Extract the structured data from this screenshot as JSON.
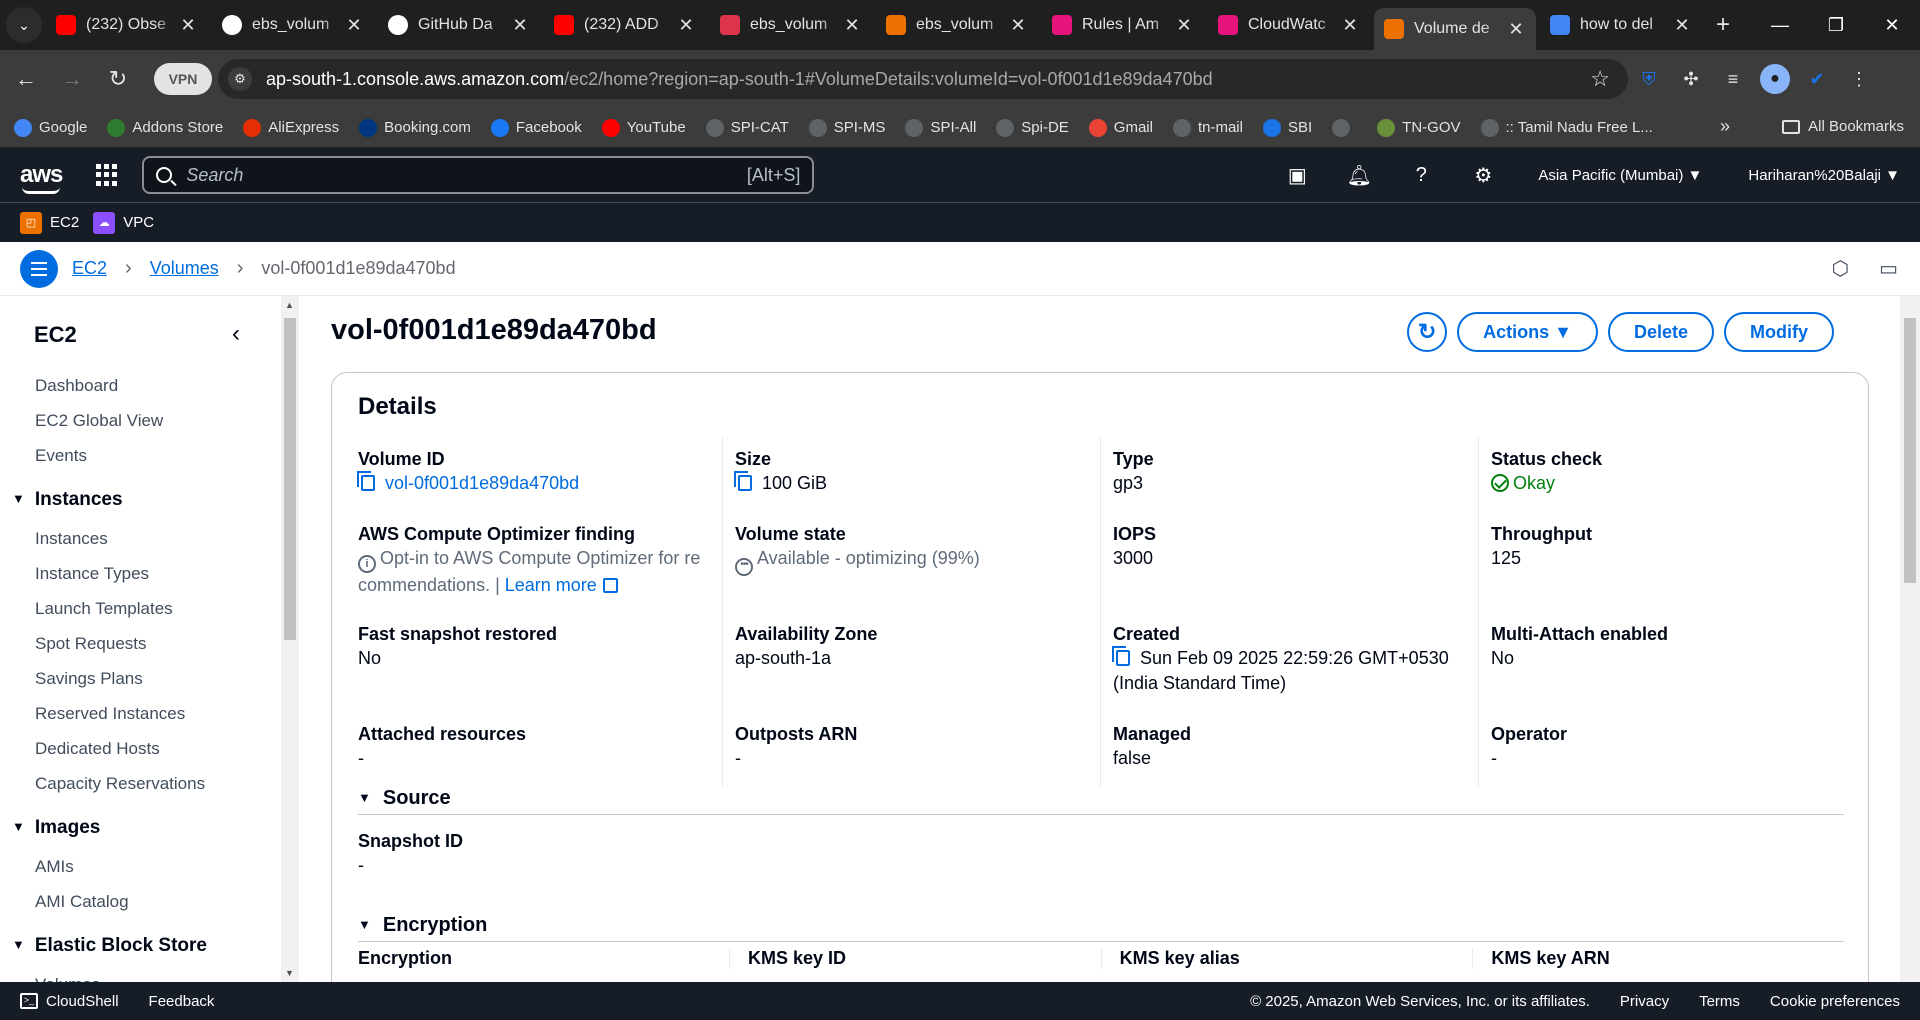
{
  "browser": {
    "tabs": [
      {
        "title": "(232) Obse",
        "favicon": "youtube-icon",
        "color": "#ff0000"
      },
      {
        "title": "ebs_volum",
        "favicon": "github-icon",
        "color": "#ffffff"
      },
      {
        "title": "GitHub Da",
        "favicon": "github-icon",
        "color": "#ffffff"
      },
      {
        "title": "(232) ADD",
        "favicon": "youtube-icon",
        "color": "#ff0000"
      },
      {
        "title": "ebs_volum",
        "favicon": "aws-ec2-icon",
        "color": "#dd344c"
      },
      {
        "title": "ebs_volum",
        "favicon": "aws-lambda-icon",
        "color": "#ed7100"
      },
      {
        "title": "Rules | Am",
        "favicon": "aws-eventbridge-icon",
        "color": "#e7157b"
      },
      {
        "title": "CloudWatc",
        "favicon": "aws-cloudwatch-icon",
        "color": "#e7157b"
      },
      {
        "title": "Volume de",
        "favicon": "aws-ec2-icon",
        "color": "#ed7100",
        "active": true
      },
      {
        "title": "how to del",
        "favicon": "google-icon",
        "color": "#4285f4"
      }
    ],
    "vpn_label": "VPN",
    "url_host": "ap-south-1.console.aws.amazon.com",
    "url_path": "/ec2/home?region=ap-south-1#VolumeDetails:volumeId=vol-0f001d1e89da470bd",
    "bookmarks": [
      {
        "label": "Google",
        "color": "#4285f4",
        "icon": "google-icon"
      },
      {
        "label": "Addons Store",
        "color": "#2e7d32",
        "icon": "addons-icon"
      },
      {
        "label": "AliExpress",
        "color": "#e62e04",
        "icon": "aliexpress-icon"
      },
      {
        "label": "Booking.com",
        "color": "#003580",
        "icon": "booking-icon"
      },
      {
        "label": "Facebook",
        "color": "#1877f2",
        "icon": "facebook-icon"
      },
      {
        "label": "YouTube",
        "color": "#ff0000",
        "icon": "youtube-icon"
      },
      {
        "label": "SPI-CAT",
        "color": "#5f6368",
        "icon": "globe-icon"
      },
      {
        "label": "SPI-MS",
        "color": "#5f6368",
        "icon": "globe-icon"
      },
      {
        "label": "SPI-All",
        "color": "#5f6368",
        "icon": "globe-icon"
      },
      {
        "label": "Spi-DE",
        "color": "#5f6368",
        "icon": "globe-icon"
      },
      {
        "label": "Gmail",
        "color": "#ea4335",
        "icon": "gmail-icon"
      },
      {
        "label": "tn-mail",
        "color": "#5f6368",
        "icon": "globe-icon"
      },
      {
        "label": "SBI",
        "color": "#1a73e8",
        "icon": "sbi-icon"
      },
      {
        "label": "",
        "color": "#5f6368",
        "icon": "globe-icon"
      },
      {
        "label": "TN-GOV",
        "color": "#6a8f3b",
        "icon": "tn-gov-icon"
      },
      {
        "label": ":: Tamil Nadu Free L...",
        "color": "#5f6368",
        "icon": "globe-icon"
      }
    ],
    "bookmarks_more": "»",
    "all_bookmarks": "All Bookmarks"
  },
  "aws": {
    "search_placeholder": "Search",
    "search_shortcut": "[Alt+S]",
    "region": "Asia Pacific (Mumbai) ▼",
    "user": "Hariharan%20Balaji ▼",
    "favorites": [
      {
        "label": "EC2",
        "color": "#ed7100"
      },
      {
        "label": "VPC",
        "color": "#8c4fff"
      }
    ]
  },
  "breadcrumb": {
    "items": [
      "EC2",
      "Volumes"
    ],
    "current": "vol-0f001d1e89da470bd"
  },
  "sidebar": {
    "title": "EC2",
    "items": [
      {
        "type": "item",
        "label": "Dashboard"
      },
      {
        "type": "item",
        "label": "EC2 Global View"
      },
      {
        "type": "item",
        "label": "Events"
      },
      {
        "type": "section",
        "label": "Instances"
      },
      {
        "type": "item",
        "label": "Instances"
      },
      {
        "type": "item",
        "label": "Instance Types"
      },
      {
        "type": "item",
        "label": "Launch Templates"
      },
      {
        "type": "item",
        "label": "Spot Requests"
      },
      {
        "type": "item",
        "label": "Savings Plans"
      },
      {
        "type": "item",
        "label": "Reserved Instances"
      },
      {
        "type": "item",
        "label": "Dedicated Hosts"
      },
      {
        "type": "item",
        "label": "Capacity Reservations"
      },
      {
        "type": "section",
        "label": "Images"
      },
      {
        "type": "item",
        "label": "AMIs"
      },
      {
        "type": "item",
        "label": "AMI Catalog"
      },
      {
        "type": "section",
        "label": "Elastic Block Store"
      },
      {
        "type": "item",
        "label": "Volumes"
      }
    ]
  },
  "page": {
    "title": "vol-0f001d1e89da470bd",
    "actions_label": "Actions ▼",
    "delete_label": "Delete",
    "modify_label": "Modify",
    "details_title": "Details",
    "details": {
      "volume_id_label": "Volume ID",
      "volume_id": "vol-0f001d1e89da470bd",
      "optimizer_label": "AWS Compute Optimizer finding",
      "optimizer_text_1": "Opt-in to AWS Compute Optimizer for re",
      "optimizer_text_2": "commendations. |",
      "learn_more": "Learn more",
      "fast_snapshot_label": "Fast snapshot restored",
      "fast_snapshot": "No",
      "attached_label": "Attached resources",
      "attached": "-",
      "size_label": "Size",
      "size": "100 GiB",
      "state_label": "Volume state",
      "state": "Available - optimizing (99%)",
      "az_label": "Availability Zone",
      "az": "ap-south-1a",
      "outposts_label": "Outposts ARN",
      "outposts": "-",
      "type_label": "Type",
      "type": "gp3",
      "iops_label": "IOPS",
      "iops": "3000",
      "created_label": "Created",
      "created_1": "Sun Feb 09 2025 22:59:26 GMT+0530",
      "created_2": "(India Standard Time)",
      "managed_label": "Managed",
      "managed": "false",
      "status_label": "Status check",
      "status": "Okay",
      "throughput_label": "Throughput",
      "throughput": "125",
      "multi_attach_label": "Multi-Attach enabled",
      "multi_attach": "No",
      "operator_label": "Operator",
      "operator": "-"
    },
    "source": {
      "title": "Source",
      "snapshot_label": "Snapshot ID",
      "snapshot": "-"
    },
    "encryption": {
      "title": "Encryption",
      "columns": [
        "Encryption",
        "KMS key ID",
        "KMS key alias",
        "KMS key ARN"
      ]
    }
  },
  "footer": {
    "cloudshell": "CloudShell",
    "feedback": "Feedback",
    "copyright": "© 2025, Amazon Web Services, Inc. or its affiliates.",
    "privacy": "Privacy",
    "terms": "Terms",
    "cookies": "Cookie preferences"
  },
  "colors": {
    "accent": "#006ce0",
    "status_ok": "#037f0c",
    "aws_nav": "#161d26"
  }
}
